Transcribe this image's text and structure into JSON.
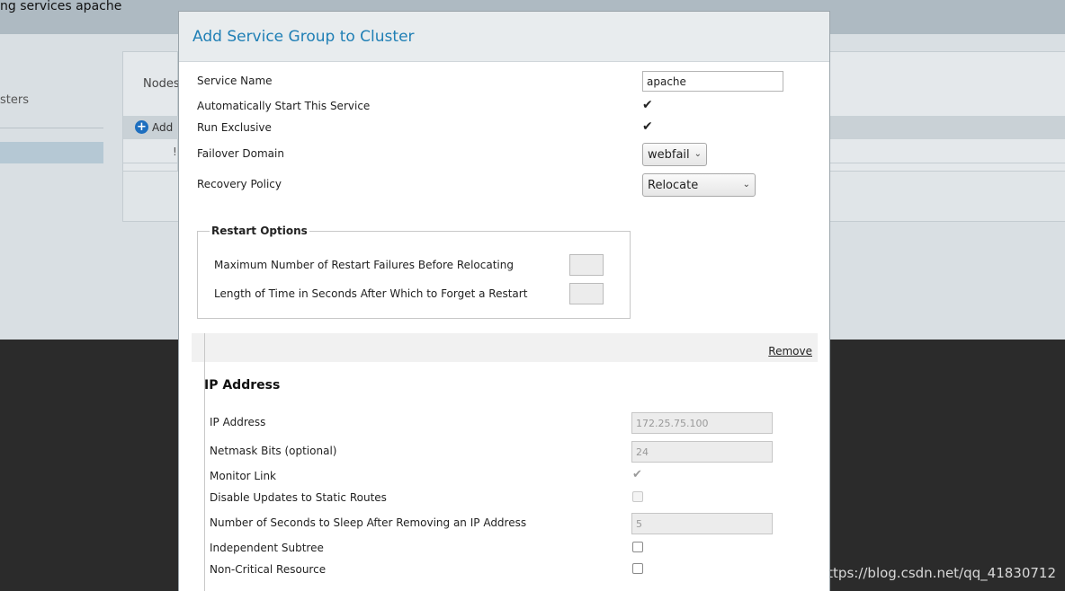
{
  "background": {
    "page_title": "ng services apache",
    "sidebar_label": "sters",
    "panel_label": "Nodes",
    "add_label": "Add",
    "row_marker": "!"
  },
  "modal": {
    "title": "Add Service Group to Cluster",
    "service_name": {
      "label": "Service Name",
      "value": "apache"
    },
    "auto_start": {
      "label": "Automatically Start This Service",
      "checked": true
    },
    "run_exclusive": {
      "label": "Run Exclusive",
      "checked": true
    },
    "failover_domain": {
      "label": "Failover Domain",
      "value": "webfail"
    },
    "recovery_policy": {
      "label": "Recovery Policy",
      "value": "Relocate"
    },
    "restart_options": {
      "legend": "Restart Options",
      "max_failures_label": "Maximum Number of Restart Failures Before Relocating",
      "forget_label": "Length of Time in Seconds After Which to Forget a Restart"
    },
    "resource": {
      "remove_label": "Remove",
      "heading": "IP Address",
      "ip_address": {
        "label": "IP Address",
        "value": "172.25.75.100"
      },
      "netmask": {
        "label": "Netmask Bits (optional)",
        "value": "24"
      },
      "monitor_link": {
        "label": "Monitor Link",
        "checked": true
      },
      "disable_updates": {
        "label": "Disable Updates to Static Routes",
        "checked": false
      },
      "sleep_seconds": {
        "label": "Number of Seconds to Sleep After Removing an IP Address",
        "value": "5"
      },
      "independent_subtree": {
        "label": "Independent Subtree",
        "checked": false
      },
      "non_critical": {
        "label": "Non-Critical Resource",
        "checked": false
      }
    }
  },
  "watermark": "https://blog.csdn.net/qq_41830712"
}
